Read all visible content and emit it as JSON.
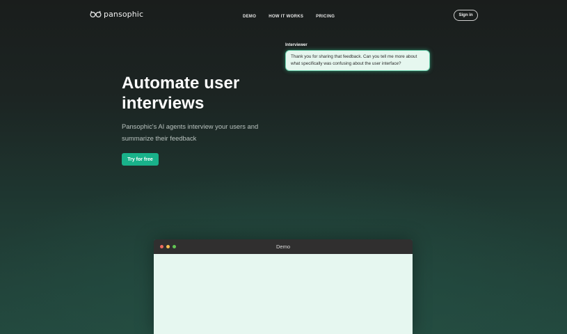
{
  "brand": {
    "name": "pansophic",
    "logo_icon": "owl-glasses-logo-icon"
  },
  "nav": {
    "links": [
      {
        "label": "DEMO"
      },
      {
        "label": "HOW IT WORKS"
      },
      {
        "label": "PRICING"
      }
    ],
    "signin_label": "Sign in"
  },
  "chat": {
    "speaker": "Interviewer",
    "message": "Thank you for sharing that feedback. Can you tell me more about what specifically was confusing about the user interface?"
  },
  "hero": {
    "title_line1": "Automate user",
    "title_line2": "interviews",
    "subtitle_line1": "Pansophic's AI agents interview your users and",
    "subtitle_line2": "summarize their feedback",
    "cta_label": "Try for free"
  },
  "demo": {
    "title": "Demo",
    "dots": [
      "#ee6b5f",
      "#f5be4f",
      "#62c554"
    ]
  },
  "colors": {
    "accent": "#19b28a",
    "bubble_bg": "#e6f7ef",
    "demo_body_bg": "#e6f7f0"
  }
}
